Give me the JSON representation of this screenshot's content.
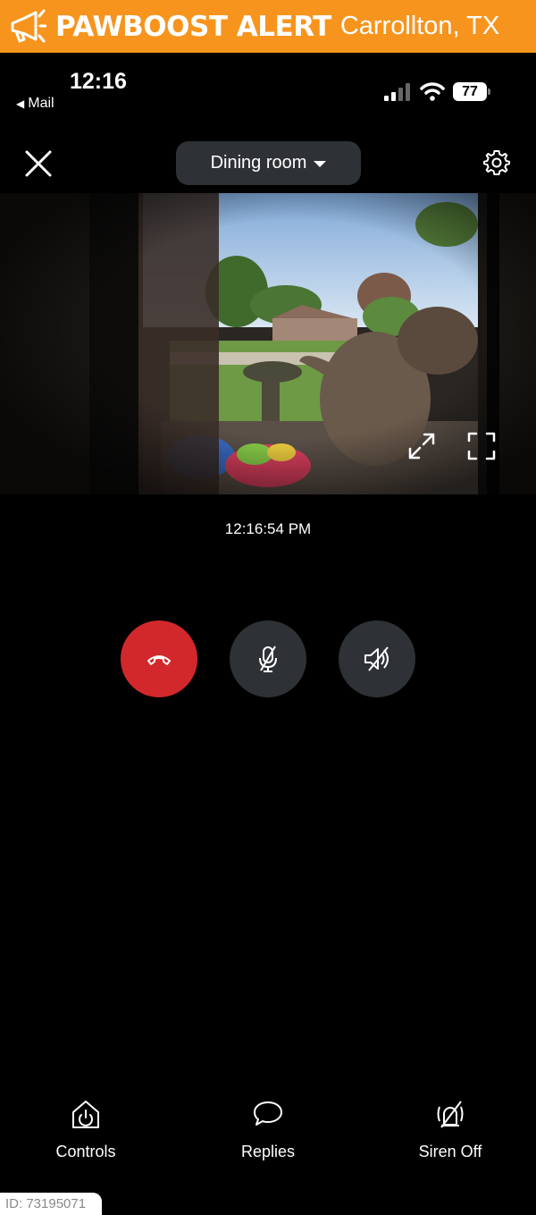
{
  "banner": {
    "brand": "PAWBOOST ALERT",
    "location": "Carrollton, TX",
    "icon": "megaphone-icon",
    "color": "#f7941d"
  },
  "status_bar": {
    "time": "12:16",
    "back_label": "Mail",
    "battery": "77"
  },
  "header": {
    "room": "Dining room"
  },
  "feed": {
    "timestamp": "12:16:54 PM"
  },
  "call_controls": {
    "hangup_color": "#d3282b",
    "button_color": "#2e3236"
  },
  "bottom_nav": {
    "controls_label": "Controls",
    "replies_label": "Replies",
    "siren_label": "Siren Off"
  },
  "watermark": {
    "id_text": "ID: 73195071"
  }
}
